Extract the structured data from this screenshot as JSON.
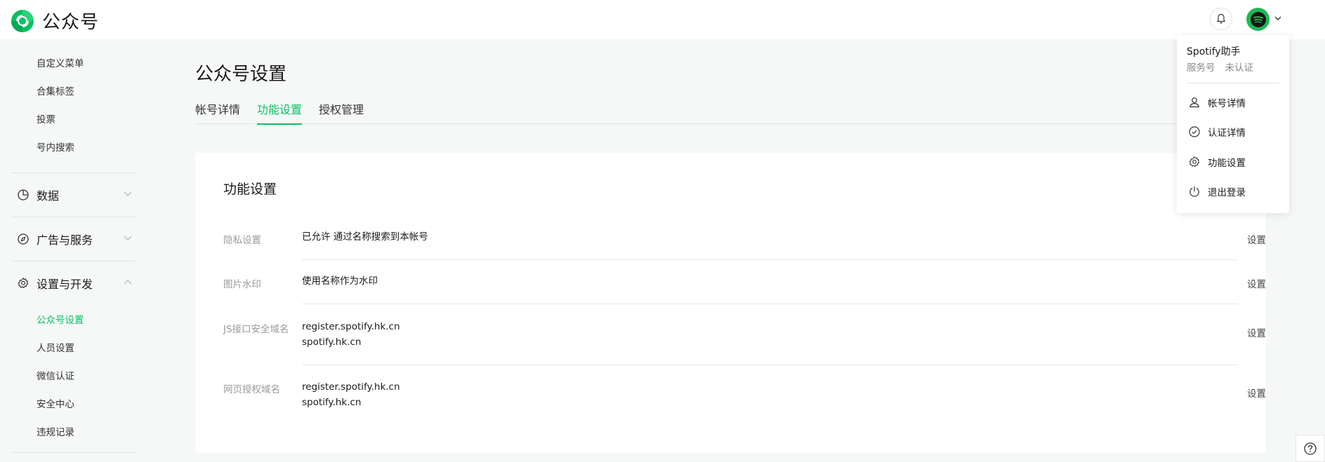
{
  "header": {
    "brand": "公众号"
  },
  "sidebar": {
    "top_items": [
      {
        "label": "自定义菜单"
      },
      {
        "label": "合集标签"
      },
      {
        "label": "投票"
      },
      {
        "label": "号内搜索"
      }
    ],
    "groups": [
      {
        "label": "数据",
        "icon": "pie-chart-icon",
        "expanded": false
      },
      {
        "label": "广告与服务",
        "icon": "compass-icon",
        "expanded": false
      },
      {
        "label": "设置与开发",
        "icon": "gear-icon",
        "expanded": true
      }
    ],
    "settings_items": [
      {
        "label": "公众号设置",
        "active": true
      },
      {
        "label": "人员设置"
      },
      {
        "label": "微信认证"
      },
      {
        "label": "安全中心"
      },
      {
        "label": "违规记录"
      }
    ]
  },
  "main": {
    "title": "公众号设置",
    "tabs": [
      {
        "label": "帐号详情"
      },
      {
        "label": "功能设置",
        "active": true
      },
      {
        "label": "授权管理"
      }
    ],
    "card": {
      "title": "功能设置",
      "rows": [
        {
          "label": "隐私设置",
          "values": [
            "已允许 通过名称搜索到本帐号"
          ],
          "action": "设置"
        },
        {
          "label": "图片水印",
          "values": [
            "使用名称作为水印"
          ],
          "action": "设置"
        },
        {
          "label": "JS接口安全域名",
          "values": [
            "register.spotify.hk.cn",
            "spotify.hk.cn"
          ],
          "action": "设置"
        },
        {
          "label": "网页授权域名",
          "values": [
            "register.spotify.hk.cn",
            "spotify.hk.cn"
          ],
          "action": "设置"
        }
      ]
    }
  },
  "account_menu": {
    "name": "Spotify助手",
    "type": "服务号",
    "status": "未认证",
    "items": [
      {
        "label": "帐号详情",
        "icon": "user-icon"
      },
      {
        "label": "认证详情",
        "icon": "check-circle-icon"
      },
      {
        "label": "功能设置",
        "icon": "gear-icon"
      },
      {
        "label": "退出登录",
        "icon": "power-icon"
      }
    ]
  },
  "colors": {
    "accent": "#07c160",
    "spotify": "#1db954",
    "background": "#f6f7f7"
  }
}
